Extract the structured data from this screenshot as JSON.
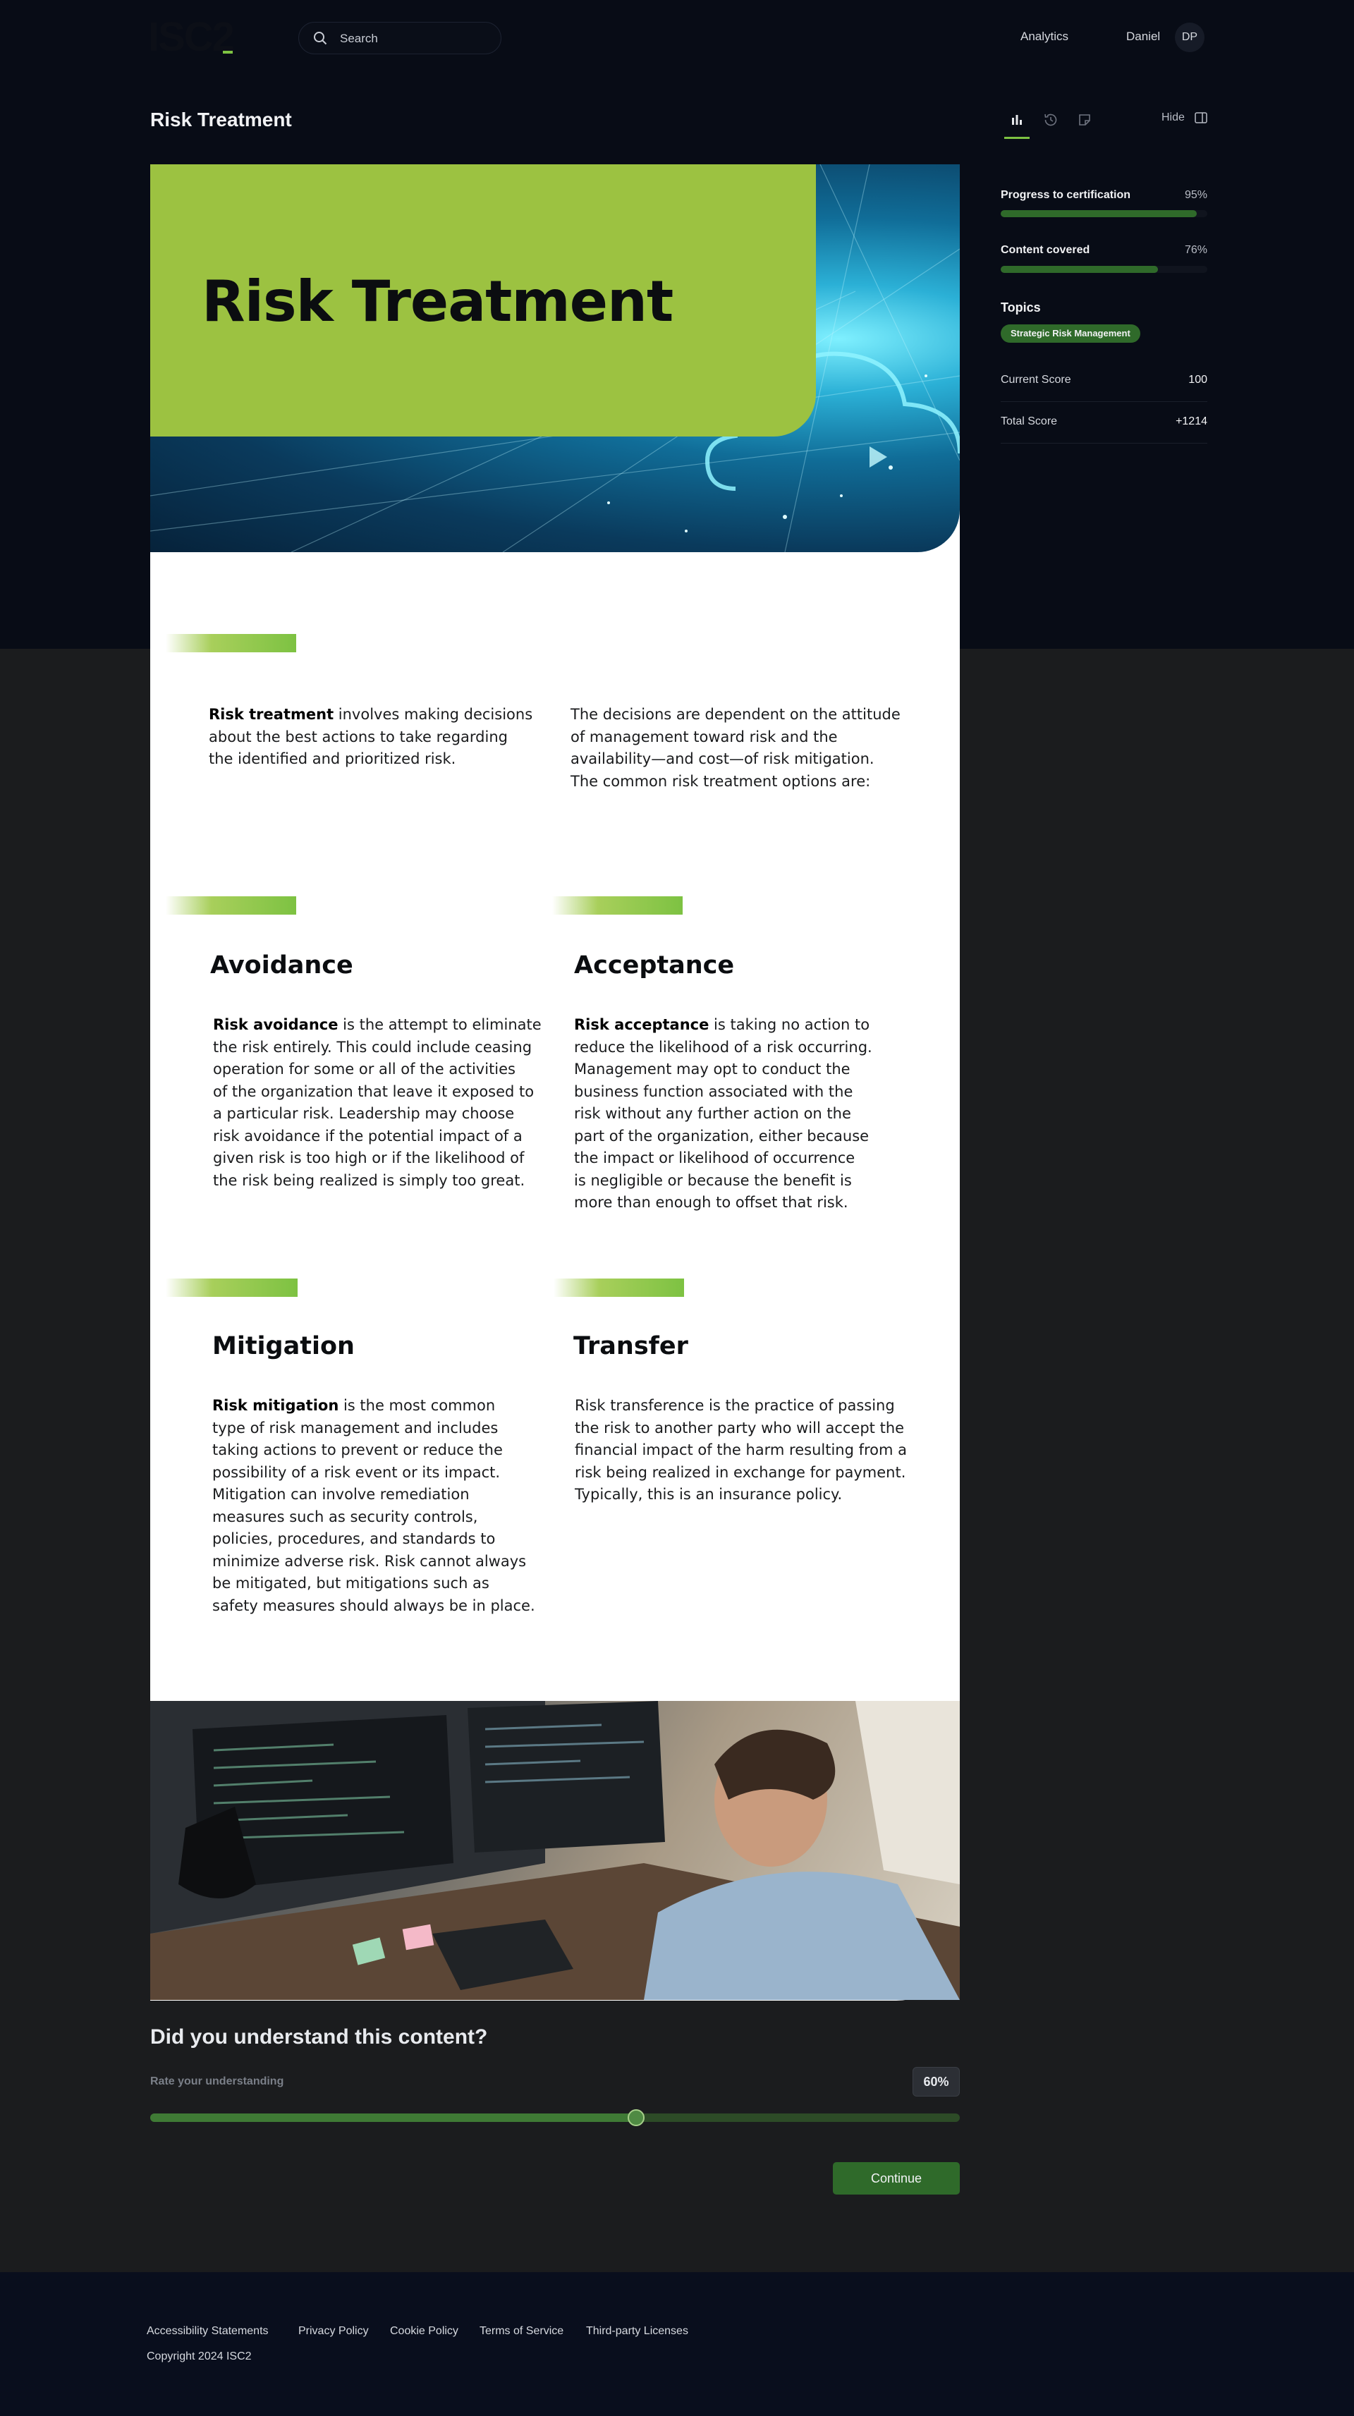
{
  "header": {
    "logo": "ISC2",
    "search_label": "Search",
    "nav_analytics": "Analytics",
    "user_name": "Daniel",
    "user_initials": "DP"
  },
  "page": {
    "title": "Risk Treatment"
  },
  "side_panel": {
    "tabs": [
      {
        "icon": "bar-chart-icon",
        "active": true
      },
      {
        "icon": "history-icon",
        "active": false
      },
      {
        "icon": "note-icon",
        "active": false
      }
    ],
    "hide_label": "Hide",
    "progress": {
      "label": "Progress to certification",
      "value_text": "95%",
      "value": 0.95
    },
    "content": {
      "label": "Content covered",
      "value_text": "76%",
      "value": 0.76
    },
    "topics_label": "Topics",
    "topic_chip": "Strategic Risk Management",
    "scores": [
      {
        "label": "Current Score",
        "value": "100"
      },
      {
        "label": "Total Score",
        "value": "+1214"
      }
    ]
  },
  "content": {
    "hero_title": "Risk Treatment",
    "intro_left_bold": "Risk treatment",
    "intro_left_rest": [
      " involves making decisions",
      "about the best actions to take regarding",
      "the identified and prioritized risk."
    ],
    "intro_right": [
      "The decisions are dependent on the attitude",
      "of management toward risk and the",
      "availability—and cost—of risk mitigation.",
      "The common risk treatment options are:"
    ],
    "sections": [
      {
        "heading": "Avoidance",
        "bold": "Risk avoidance",
        "lines": [
          " is the attempt to eliminate",
          "the risk entirely. This could include ceasing",
          "operation for some or all of the activities",
          "of the organization that leave it exposed to",
          "a particular risk. Leadership may choose",
          "risk avoidance if the potential impact of a",
          "given risk is too high or if the likelihood of",
          "the risk being realized is simply too great."
        ]
      },
      {
        "heading": "Acceptance",
        "bold": "Risk acceptance",
        "lines": [
          " is taking no action to",
          "reduce the likelihood of a risk occurring.",
          "Management may opt to conduct the",
          "business function associated with the",
          "risk without any further action on the",
          "part of the organization, either because",
          "the impact or likelihood of occurrence",
          "is negligible or because the benefit is",
          "more than enough to offset that risk."
        ]
      },
      {
        "heading": "Mitigation",
        "bold": "Risk mitigation",
        "lines": [
          " is the most common",
          "type of risk management and includes",
          "taking actions to prevent or reduce the",
          "possibility of a risk event or its impact.",
          "Mitigation can involve remediation",
          "measures such as security controls,",
          "policies, procedures, and standards to",
          "minimize adverse risk. Risk cannot always",
          "be mitigated, but mitigations such as",
          "safety measures should always be in place."
        ]
      },
      {
        "heading": "Transfer",
        "bold": "",
        "lines": [
          "Risk transference is the practice of passing",
          "the risk to another party who will accept the",
          "financial impact of the harm resulting from a",
          "risk being realized in exchange for payment.",
          "Typically, this is an insurance policy."
        ]
      }
    ]
  },
  "question": {
    "title": "Did you understand this content?",
    "subtitle": "Rate your understanding",
    "value_text": "60%",
    "value": 0.6,
    "continue_label": "Continue"
  },
  "footer": {
    "links": [
      "Accessibility Statements",
      "Privacy Policy",
      "Cookie Policy",
      "Terms of Service",
      "Third-party Licenses"
    ],
    "copyright": "Copyright 2024 ISC2"
  },
  "colors": {
    "accent_green": "#2f6a2a",
    "hero_green": "#9cc241",
    "divider_green": "#7dc242",
    "header_bg": "#080c16",
    "body_bg": "#1b1c1e"
  }
}
